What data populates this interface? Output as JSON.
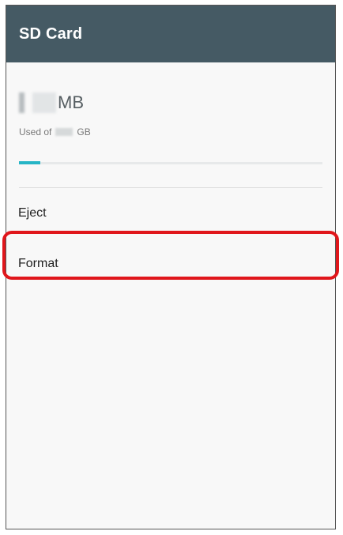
{
  "header": {
    "title": "SD Card"
  },
  "storage": {
    "used_unit": "MB",
    "used_of_label": "Used of",
    "total_unit": "GB",
    "progress": 0.07,
    "progress_color": "#26b5c6"
  },
  "menu": {
    "items": [
      {
        "label": "Eject"
      },
      {
        "label": "Format"
      }
    ]
  },
  "colors": {
    "appbar": "#455a64",
    "highlight": "#e0161b"
  }
}
